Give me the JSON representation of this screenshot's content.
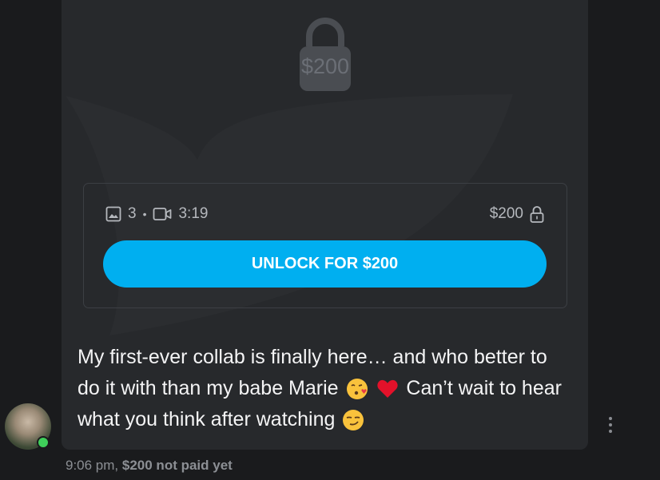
{
  "message": {
    "locked_price": "$200",
    "media": {
      "photos_count": "3",
      "separator": "•",
      "video_duration": "3:19",
      "price": "$200"
    },
    "unlock_label": "UNLOCK FOR $200",
    "text_parts": [
      "My first-ever collab is finally here… and who better to do it with than my babe Marie",
      "Can’t wait to hear what you think after watching"
    ],
    "emojis": [
      "face-blowing-kiss-emoji",
      "red-heart-emoji",
      "smirking-face-emoji"
    ]
  },
  "footer": {
    "time": "9:06 pm,",
    "status": "$200 not paid yet"
  },
  "colors": {
    "accent": "#00aff0",
    "online": "#3fcf5a",
    "background": "#1a1b1d",
    "card": "#27292c"
  },
  "icons": [
    "lock-icon",
    "image-icon",
    "video-icon",
    "more-icon"
  ]
}
